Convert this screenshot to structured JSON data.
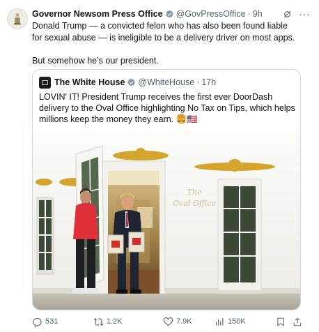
{
  "tweet": {
    "author_name": "Governor Newsom Press Office",
    "handle": "@GovPressOffice",
    "separator": "·",
    "time": "9h",
    "text_line1": "Donald Trump — a convicted felon who has also been found liable for sexual abuse — is ineligible to be a delivery driver on most apps.",
    "text_line2": "But somehow he’s our president.",
    "more_label": "···"
  },
  "quote": {
    "author_name": "The White House",
    "handle": "@WhiteHouse",
    "separator": "·",
    "time": "17h",
    "text": "LOVIN' IT! President Trump receives the first ever DoorDash delivery to the Oval Office highlighting No Tax on Tips, which helps millions keep the money they earn. 🍔🇺🇸",
    "image": {
      "door_sign_line1": "The",
      "door_sign_line2": "Oval Office"
    }
  },
  "actions": {
    "replies": "531",
    "reposts": "1.2K",
    "likes": "7.9K",
    "views": "150K"
  },
  "colors": {
    "verified": "#829aab",
    "text": "#0f1419",
    "muted": "#536471",
    "border": "#cfd9de"
  },
  "icons": [
    "reply-icon",
    "repost-icon",
    "like-icon",
    "views-icon",
    "bookmark-icon",
    "share-icon",
    "grok-icon",
    "more-icon",
    "verified-badge-icon"
  ]
}
